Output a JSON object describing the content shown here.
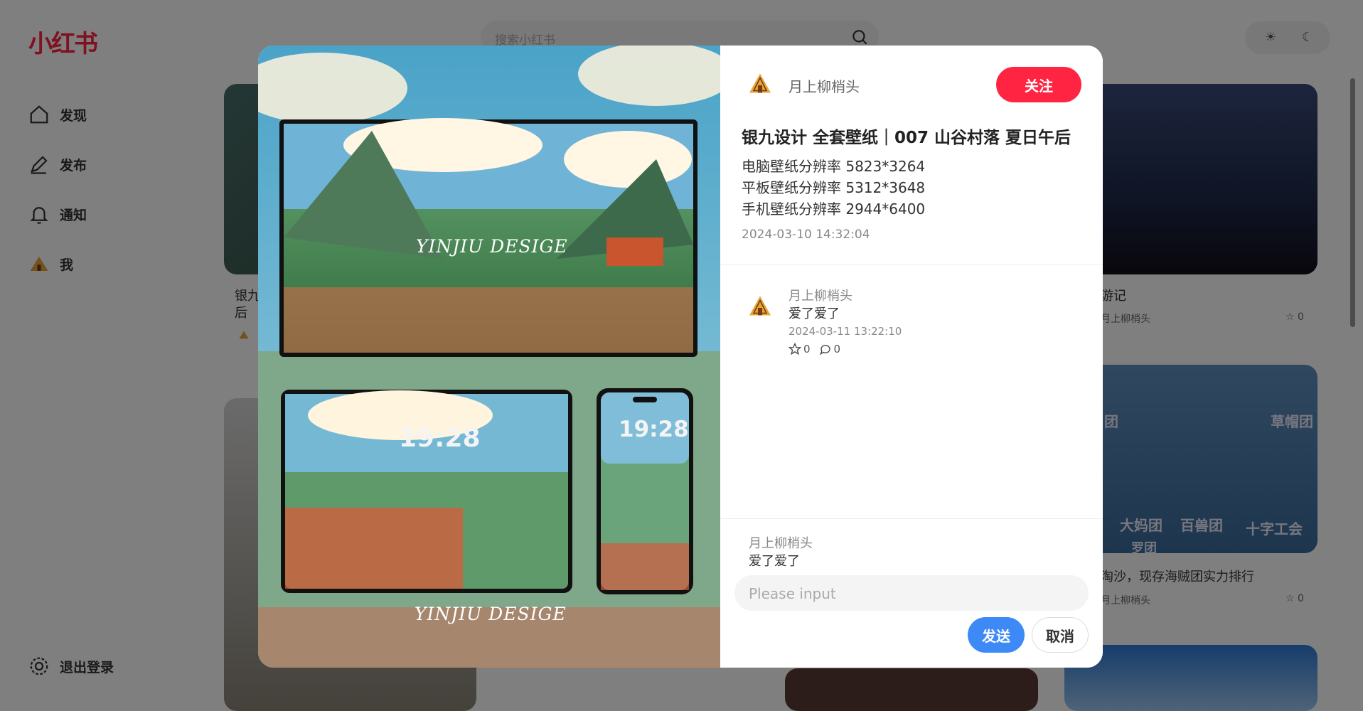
{
  "app": {
    "logo": "小红书"
  },
  "search": {
    "placeholder": "搜索小红书"
  },
  "nav": [
    {
      "label": "发现",
      "icon": "home-icon"
    },
    {
      "label": "发布",
      "icon": "pen-icon"
    },
    {
      "label": "通知",
      "icon": "bell-icon"
    },
    {
      "label": "我",
      "icon": "avatar-icon"
    }
  ],
  "logout": {
    "label": "退出登录",
    "icon": "gear-icon"
  },
  "feed": {
    "card1": {
      "title_line1": "银九",
      "title_line2": "后"
    },
    "card2": {
      "title": "游记",
      "author": "月上柳梢头",
      "likes": "0"
    },
    "card3": {
      "title": "淘沙，现存海贼团实力排行",
      "author": "月上柳梢头",
      "likes": "0",
      "overlay_labels": [
        "团",
        "草帽团",
        "大妈团",
        "百兽团",
        "十字工会",
        "罗团"
      ]
    }
  },
  "modal": {
    "image_captions": [
      "YINJIU DESIGE",
      "YINJIU DESIGE"
    ],
    "tablet_time": "19:28",
    "phone_time": "19:28",
    "author": {
      "name": "月上柳梢头",
      "follow_label": "关注"
    },
    "post": {
      "title": "银九设计 全套壁纸｜007 山谷村落 夏日午后",
      "desc": [
        "电脑壁纸分辨率 5823*3264",
        "平板壁纸分辨率 5312*3648",
        "手机壁纸分辨率 2944*6400"
      ],
      "time": "2024-03-10 14:32:04"
    },
    "comments": [
      {
        "name": "月上柳梢头",
        "text": "爱了爱了",
        "time": "2024-03-11 13:22:10",
        "likes": "0",
        "replies": "0"
      }
    ],
    "reply_preview": {
      "name": "月上柳梢头",
      "text": "爱了爱了"
    },
    "input": {
      "placeholder": "Please input"
    },
    "send_label": "发送",
    "cancel_label": "取消"
  },
  "colors": {
    "brand": "#ff2442",
    "send": "#3d8af7"
  }
}
